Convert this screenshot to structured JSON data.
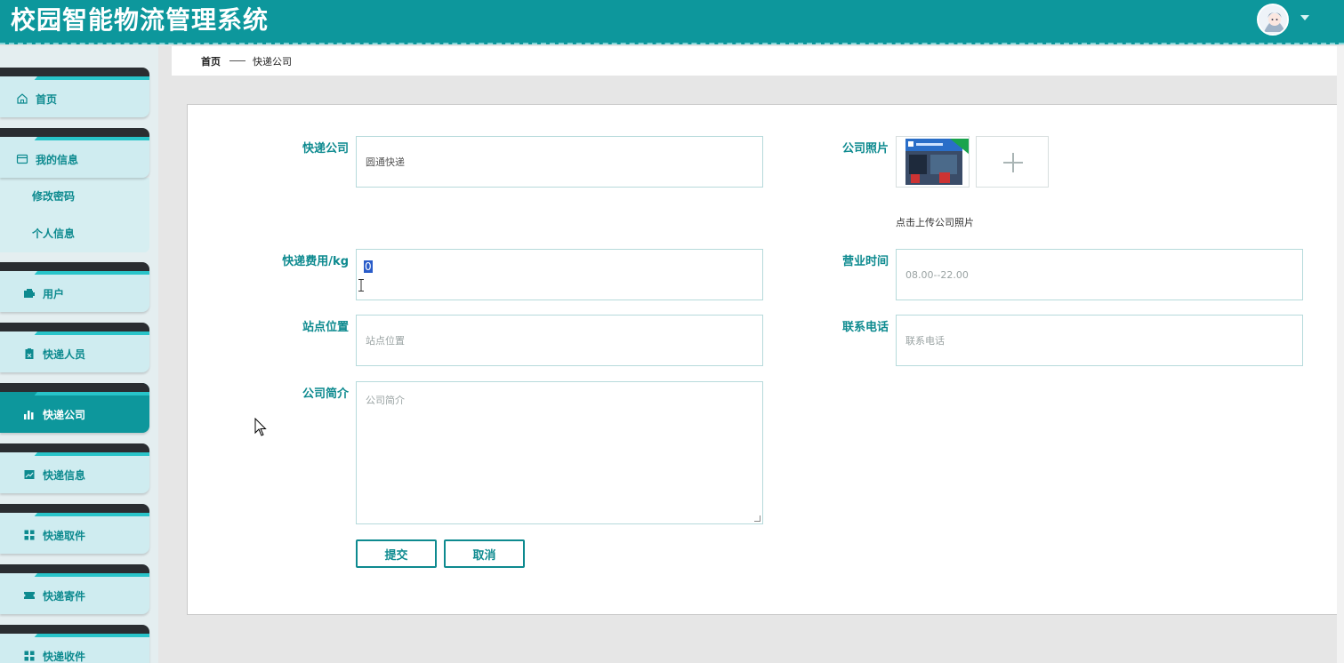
{
  "app": {
    "title": "校园智能物流管理系统"
  },
  "breadcrumb": {
    "home": "首页",
    "current": "快递公司"
  },
  "sidebar": {
    "items": [
      {
        "label": "首页",
        "icon": "home-icon"
      },
      {
        "label": "我的信息",
        "icon": "card-icon",
        "children": [
          "修改密码",
          "个人信息"
        ]
      },
      {
        "label": "用户",
        "icon": "wallet-icon"
      },
      {
        "label": "快递人员",
        "icon": "clipboard-icon"
      },
      {
        "label": "快递公司",
        "icon": "bar-chart-icon",
        "active": true
      },
      {
        "label": "快递信息",
        "icon": "trend-icon"
      },
      {
        "label": "快递取件",
        "icon": "grid-icon"
      },
      {
        "label": "快递寄件",
        "icon": "ticket-icon"
      },
      {
        "label": "快递收件",
        "icon": "grid-icon"
      }
    ]
  },
  "form": {
    "company": {
      "label": "快递公司",
      "value": "圆通快递"
    },
    "photo": {
      "label": "公司照片",
      "hint": "点击上传公司照片"
    },
    "fee": {
      "label": "快递费用/kg",
      "value": "0"
    },
    "hours": {
      "label": "营业时间",
      "value": "08.00--22.00"
    },
    "location": {
      "label": "站点位置",
      "placeholder": "站点位置"
    },
    "phone": {
      "label": "联系电话",
      "placeholder": "联系电话"
    },
    "intro": {
      "label": "公司简介",
      "placeholder": "公司简介"
    },
    "submit_label": "提交",
    "cancel_label": "取消"
  },
  "colors": {
    "brand": "#0d979c",
    "accent": "#28c4c9"
  }
}
